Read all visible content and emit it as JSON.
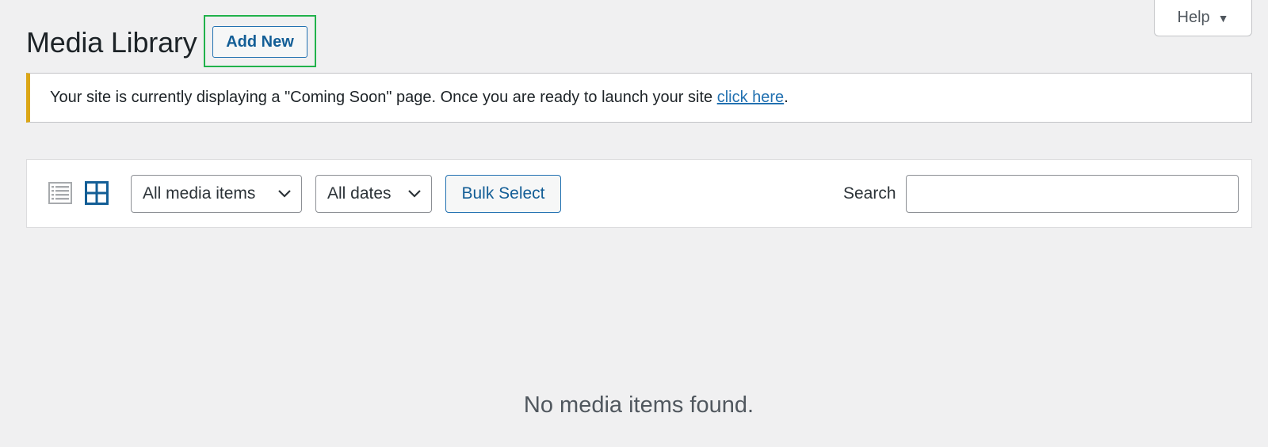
{
  "header": {
    "title": "Media Library",
    "add_new_label": "Add New",
    "help_label": "Help"
  },
  "notice": {
    "text_before": "Your site is currently displaying a \"Coming Soon\" page. Once you are ready to launch your site ",
    "link_text": "click here",
    "text_after": "."
  },
  "toolbar": {
    "view_list_icon": "list-view-icon",
    "view_grid_icon": "grid-view-icon",
    "media_filter_value": "All media items",
    "date_filter_value": "All dates",
    "bulk_select_label": "Bulk Select",
    "search_label": "Search",
    "search_value": ""
  },
  "main": {
    "empty_message": "No media items found."
  },
  "colors": {
    "accent_blue": "#2271b1",
    "notice_warning": "#dba617",
    "highlight_green": "#21b24b"
  }
}
